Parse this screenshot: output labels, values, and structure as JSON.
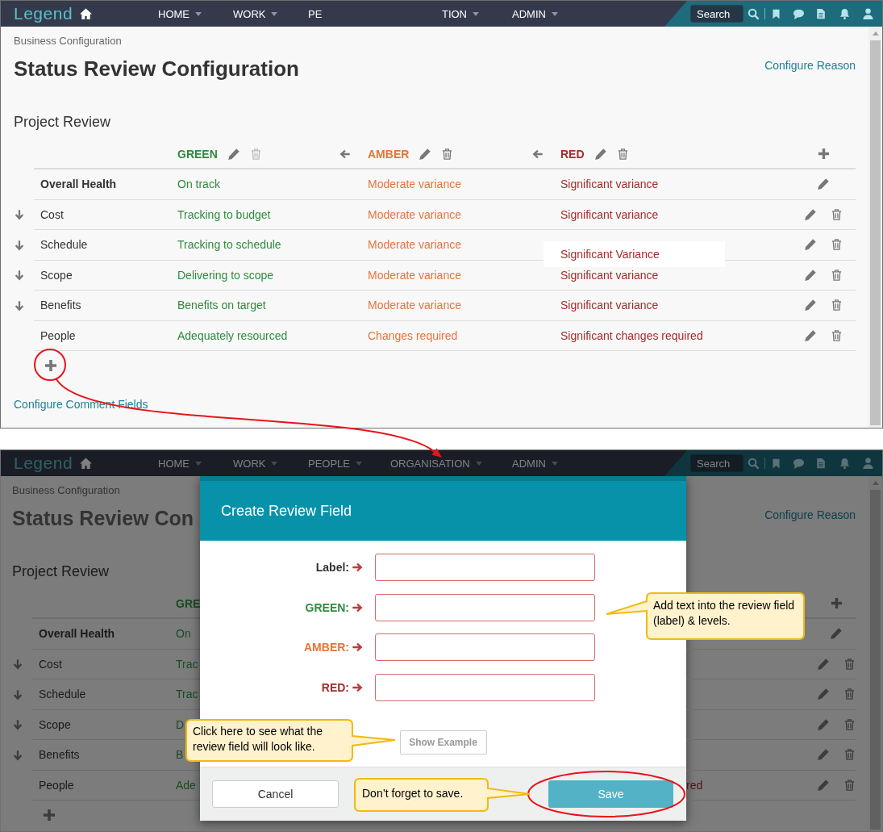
{
  "top_screen": {
    "nav": {
      "logo": "Legend",
      "search_placeholder": "Search",
      "items": [
        {
          "label": "HOME",
          "caret": true,
          "cut_start": false
        },
        {
          "label": "WORK",
          "caret": true,
          "cut_start": false
        },
        {
          "label": "PE",
          "caret": false,
          "cut_start": false
        },
        {
          "label": "TION",
          "caret": true,
          "cut_start": true
        },
        {
          "label": "ADMIN",
          "caret": true,
          "cut_start": false
        }
      ]
    },
    "breadcrumb": "Business Configuration",
    "title": "Status Review Configuration",
    "side_link": "Configure Reason",
    "section": "Project Review",
    "columns": [
      {
        "label": "GREEN",
        "color": "#2e8b3e",
        "movable": false,
        "deletable": false
      },
      {
        "label": "AMBER",
        "color": "#e8733a",
        "movable": true,
        "deletable": true
      },
      {
        "label": "RED",
        "color": "#a52c2c",
        "movable": true,
        "deletable": true
      }
    ],
    "rows": [
      {
        "kind": "summary",
        "label": "Overall Health",
        "movable": false,
        "editing": false,
        "cells": [
          "On track",
          "Moderate variance",
          "Significant variance"
        ]
      },
      {
        "kind": "field",
        "label": "Cost",
        "movable": true,
        "editing": false,
        "cells": [
          "Tracking to budget",
          "Moderate variance",
          "Significant variance"
        ]
      },
      {
        "kind": "field",
        "label": "Schedule",
        "movable": true,
        "editing": true,
        "cells": [
          "Tracking to schedule",
          "Moderate variance",
          "Significant Variance"
        ]
      },
      {
        "kind": "field",
        "label": "Scope",
        "movable": true,
        "editing": false,
        "cells": [
          "Delivering to scope",
          "Moderate variance",
          "Significant variance"
        ]
      },
      {
        "kind": "field",
        "label": "Benefits",
        "movable": true,
        "editing": false,
        "cells": [
          "Benefits on target",
          "Moderate variance",
          "Significant variance"
        ]
      },
      {
        "kind": "field",
        "label": "People",
        "movable": false,
        "editing": false,
        "cells": [
          "Adequately resourced",
          "Changes required",
          "Significant changes required"
        ]
      }
    ],
    "footer_link": "Configure Comment Fields"
  },
  "bottom_screen": {
    "nav": {
      "logo": "Legend",
      "search_placeholder": "Search",
      "items": [
        {
          "label": "HOME",
          "caret": true,
          "cut_start": false
        },
        {
          "label": "WORK",
          "caret": true,
          "cut_start": false
        },
        {
          "label": "PEOPLE",
          "caret": true,
          "cut_start": false
        },
        {
          "label": "ORGANISATION",
          "caret": true,
          "cut_start": false
        },
        {
          "label": "ADMIN",
          "caret": true,
          "cut_start": false
        }
      ]
    },
    "left": {
      "breadcrumb": "Business Configuration",
      "title": "Status Review Con",
      "section": "Project Review",
      "column": {
        "label": "GRE",
        "color": "#1d4a22"
      },
      "rows": [
        {
          "kind": "summary",
          "label": "Overall Health",
          "movable": false,
          "cell": "On"
        },
        {
          "kind": "field",
          "label": "Cost",
          "movable": true,
          "cell": "Trac"
        },
        {
          "kind": "field",
          "label": "Schedule",
          "movable": true,
          "cell": "Trac"
        },
        {
          "kind": "field",
          "label": "Scope",
          "movable": true,
          "cell": "D"
        },
        {
          "kind": "field",
          "label": "Benefits",
          "movable": true,
          "cell": "B"
        },
        {
          "kind": "field",
          "label": "People",
          "movable": false,
          "cell": "Ade"
        }
      ]
    },
    "right": {
      "side_link": "Configure Reason",
      "rows": [
        {
          "kind": "summary"
        },
        {
          "kind": "field"
        },
        {
          "kind": "field"
        },
        {
          "kind": "field"
        },
        {
          "kind": "field"
        },
        {
          "kind": "field",
          "cell": "red"
        }
      ]
    },
    "dialog": {
      "title": "Create Review Field",
      "fields": [
        {
          "label": "Label:",
          "color": "#333333"
        },
        {
          "label": "GREEN:",
          "color": "#2e8b3e"
        },
        {
          "label": "AMBER:",
          "color": "#e8733a"
        },
        {
          "label": "RED:",
          "color": "#a52c2c"
        }
      ],
      "example_button": "Show Example",
      "cancel_button": "Cancel",
      "save_button": "Save"
    }
  },
  "callouts": [
    {
      "text": "Add text into the review field (label) & levels."
    },
    {
      "text": "Click here to see what the review field will look like."
    },
    {
      "text": "Don’t forget to save."
    }
  ]
}
